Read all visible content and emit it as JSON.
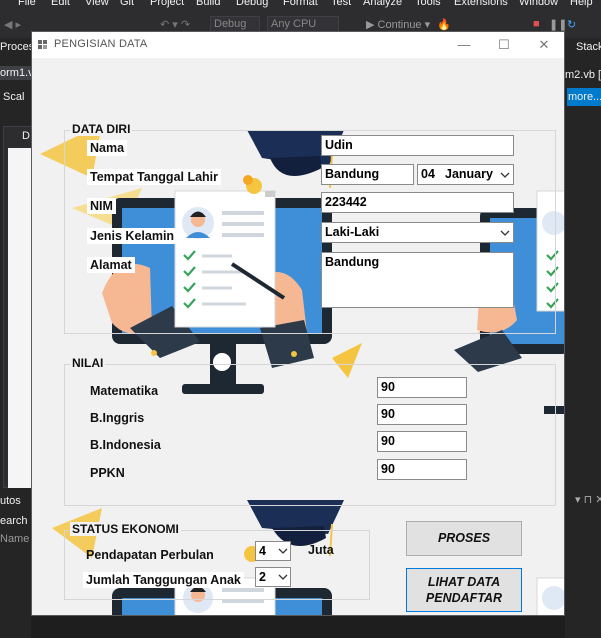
{
  "ide": {
    "menu_items": [
      "File",
      "Edit",
      "View",
      "Git",
      "Project",
      "Build",
      "Debug",
      "Format",
      "Test",
      "Analyze",
      "Tools",
      "Extensions",
      "Window",
      "Help"
    ],
    "config_combo": "Debug",
    "platform_combo": "Any CPU",
    "continue_label": "▶ Continue ▾",
    "left_labels": [
      "Proces",
      "orm1.vb",
      "Scal",
      "D",
      "utos",
      "earch (",
      "Name"
    ],
    "right_labels": [
      "Stack",
      "m2.vb [D",
      "more..."
    ]
  },
  "window": {
    "title": "PENGISIAN DATA",
    "minimize_glyph": "—",
    "maximize_glyph": "☐",
    "close_glyph": "✕"
  },
  "data_diri": {
    "group_title": "DATA DIRI",
    "labels": {
      "nama": "Nama",
      "ttl": "Tempat Tanggal Lahir",
      "nim": "NIM",
      "jenis_kelamin": "Jenis Kelamin",
      "alamat": "Alamat"
    },
    "values": {
      "nama": "Udin",
      "tempat": "Bandung",
      "tanggal_day": "04",
      "tanggal_month": "January",
      "nim": "223442",
      "jenis_kelamin": "Laki-Laki",
      "alamat": "Bandung"
    }
  },
  "nilai": {
    "group_title": "NILAI",
    "labels": {
      "matematika": "Matematika",
      "b_inggris": "B.Inggris",
      "b_indonesia": "B.Indonesia",
      "ppkn": "PPKN"
    },
    "values": {
      "matematika": "90",
      "b_inggris": "90",
      "b_indonesia": "90",
      "ppkn": "90"
    }
  },
  "status_ekonomi": {
    "group_title": "STATUS EKONOMI",
    "labels": {
      "pendapatan": "Pendapatan Perbulan",
      "tanggungan": "Jumlah Tanggungan Anak",
      "juta": "Juta"
    },
    "values": {
      "pendapatan": "4",
      "tanggungan": "2"
    }
  },
  "buttons": {
    "proses": "PROSES",
    "lihat_data_line1": "LIHAT DATA",
    "lihat_data_line2": "PENDAFTAR"
  },
  "colors": {
    "monitor_blue": "#3f8fd8",
    "monitor_dark": "#1e2833",
    "cap_navy": "#1b2e55",
    "accent_yellow": "#f5c542",
    "skin": "#f6b893",
    "check_green": "#3aa35a",
    "button_border_focus": "#0078d7"
  },
  "icons": [
    "form-icon",
    "minimize-icon",
    "maximize-icon",
    "close-icon",
    "chevron-down-icon",
    "graduation-cap-icon",
    "monitor-icon",
    "student-avatar-icon",
    "checkmark-icon",
    "pen-icon"
  ]
}
